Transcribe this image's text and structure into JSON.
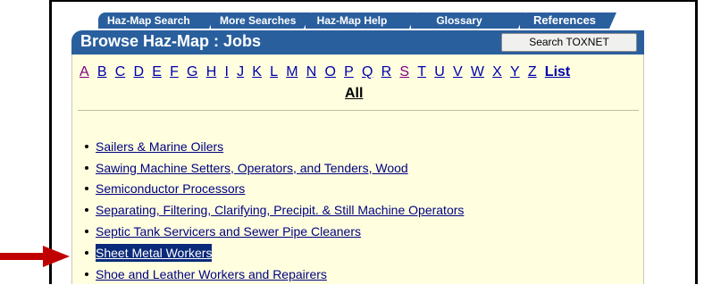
{
  "tabs": [
    "Haz-Map Search",
    "More Searches",
    "Haz-Map Help",
    "Glossary",
    "References"
  ],
  "header": {
    "title": "Browse Haz-Map : Jobs",
    "search_button": "Search TOXNET"
  },
  "alphabet": [
    "A",
    "B",
    "C",
    "D",
    "E",
    "F",
    "G",
    "H",
    "I",
    "J",
    "K",
    "L",
    "M",
    "N",
    "O",
    "P",
    "Q",
    "R",
    "S",
    "T",
    "U",
    "V",
    "W",
    "X",
    "Y",
    "Z"
  ],
  "list_label": "List",
  "all_label": "All",
  "jobs": [
    "Sailers & Marine Oilers",
    "Sawing Machine Setters, Operators, and Tenders, Wood",
    "Semiconductor Processors",
    "Separating, Filtering, Clarifying, Precipit. & Still Machine Operators",
    "Septic Tank Servicers and Sewer Pipe Cleaners",
    "Sheet Metal Workers",
    "Shoe and Leather Workers and Repairers"
  ],
  "highlighted_job_index": 5,
  "colors": {
    "brand_blue": "#2a5f9e",
    "panel_bg": "#ffffe0",
    "link": "#0000aa",
    "visited": "#800080",
    "highlight": "#0a2a7a",
    "arrow": "#c00000"
  }
}
